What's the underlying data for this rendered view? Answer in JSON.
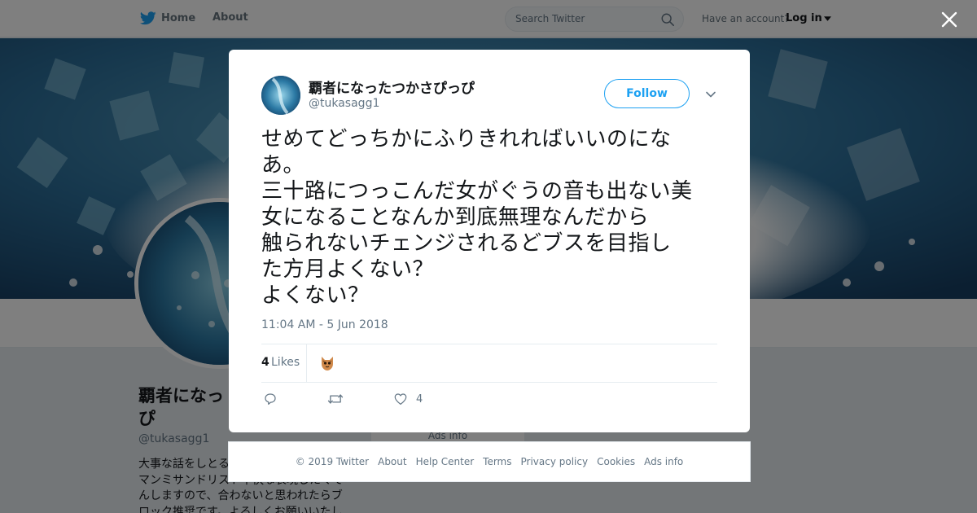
{
  "topbar": {
    "home_label": "Home",
    "about_label": "About",
    "search_placeholder": "Search Twitter",
    "have_account": "Have an account?",
    "login_label": "Log in"
  },
  "profile": {
    "name": "覇者になったつかさぴっぴ",
    "name_visible": "覇者になっ\nぴ",
    "handle": "@tukasagg1",
    "bio_visible": "大事な話をしとる\nマンミサンドリスト不快な表現したくで\nんしますので、合わないと思われたらブ\nロック推奨です。よろしくお願いいたし",
    "ads_info": "Ads info"
  },
  "tweet": {
    "author_name": "覇者になったつかさぴっぴ",
    "author_handle": "@tukasagg1",
    "follow_label": "Follow",
    "text": "せめてどっちかにふりきれればいいのにな\nあ。\n三十路につっこんだ女がぐうの音も出ない美\n女になることなんか到底無理なんだから\n触られないチェンジされるどブスを目指し\nた方月よくない？\nよくない？",
    "timestamp": "11:04 AM - 5 Jun 2018",
    "likes_count": "4",
    "likes_label": "Likes",
    "like_action_count": "4"
  },
  "footer": {
    "links": [
      "© 2019 Twitter",
      "About",
      "Help Center",
      "Terms",
      "Privacy policy",
      "Cookies",
      "Ads info"
    ]
  },
  "colors": {
    "twitter_blue": "#1da1f2",
    "text_gray": "#657786",
    "banner_blue": "#2c6f9a"
  },
  "icons": [
    "twitter-bird-icon",
    "search-icon",
    "caret-down-icon",
    "close-icon",
    "chevron-down-icon",
    "reply-icon",
    "retweet-icon",
    "heart-icon"
  ]
}
